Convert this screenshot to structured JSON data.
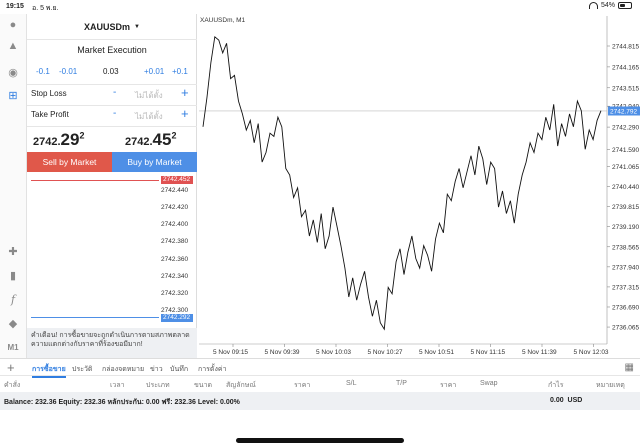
{
  "status": {
    "time": "19:15",
    "date": "อ. 5 พ.ย.",
    "battery": "54%",
    "battery_level": 0.54
  },
  "toolbar": {
    "icons": [
      "person-icon",
      "chat-icon",
      "add-order-icon",
      "crosshair-icon",
      "indicators-icon",
      "function-icon",
      "objects-icon",
      "timeframe-label"
    ],
    "timeframe": "M1"
  },
  "trade": {
    "symbol": "XAUUSDm",
    "execution": "Market Execution",
    "volume_steps": [
      "-0.1",
      "-0.01",
      "+0.01",
      "+0.1"
    ],
    "volume": "0.03",
    "stop_loss_label": "Stop Loss",
    "take_profit_label": "Take Profit",
    "placeholder": "ไม่ได้ตั้ง",
    "minus": "-",
    "plus": "+",
    "sell_price": {
      "small": "2742.",
      "big": "29",
      "sup": "2"
    },
    "buy_price": {
      "small": "2742.",
      "big": "45",
      "sup": "2"
    },
    "sell_label": "Sell by Market",
    "buy_label": "Buy by Market",
    "depth_top_tag": "2742.452",
    "depth_levels": [
      "2742.440",
      "2742.420",
      "2742.400",
      "2742.380",
      "2742.360",
      "2742.340",
      "2742.320",
      "2742.300"
    ],
    "depth_bottom_tag": "2742.292",
    "warning": "คำเตือน! การซื้อขายจะถูกดำเนินการตามสภาพตลาด ความแตกต่างกับราคาที่ร้องขอมีมาก!"
  },
  "chart_data": {
    "type": "line",
    "title": "XAUUSDm, M1",
    "y_ticks": [
      "2744.815",
      "2744.165",
      "2743.515",
      "2742.940",
      "2742.290",
      "2741.590",
      "2741.065",
      "2740.440",
      "2739.815",
      "2739.190",
      "2738.565",
      "2737.940",
      "2737.315",
      "2736.690",
      "2736.065"
    ],
    "current_price": "2742.792",
    "x_ticks": [
      "5 Nov 09:15",
      "5 Nov 09:39",
      "5 Nov 10:03",
      "5 Nov 10:27",
      "5 Nov 10:51",
      "5 Nov 11:15",
      "5 Nov 11:39",
      "5 Nov 12:03"
    ],
    "ylim": [
      2735.6,
      2745.5
    ],
    "series": [
      {
        "values": [
          2742.3,
          2743.2,
          2744.3,
          2745.1,
          2745.0,
          2744.6,
          2744.9,
          2743.8,
          2743.9,
          2743.1,
          2742.7,
          2742.2,
          2742.5,
          2741.8,
          2742.4,
          2741.2,
          2741.5,
          2742.1,
          2742.0,
          2742.6,
          2742.3,
          2741.0,
          2740.8,
          2740.1,
          2740.4,
          2739.5,
          2739.7,
          2738.9,
          2739.4,
          2738.7,
          2739.6,
          2738.5,
          2738.9,
          2739.8,
          2739.2,
          2738.6,
          2737.9,
          2737.0,
          2737.6,
          2736.9,
          2737.4,
          2737.8,
          2737.0,
          2736.4,
          2736.9,
          2736.2,
          2736.0,
          2737.3,
          2737.1,
          2738.1,
          2738.5,
          2737.7,
          2738.4,
          2738.9,
          2738.2,
          2737.9,
          2738.6,
          2738.3,
          2737.8,
          2738.8,
          2739.3,
          2739.0,
          2740.2,
          2740.0,
          2740.6,
          2741.0,
          2740.4,
          2740.9,
          2741.4,
          2740.8,
          2741.7,
          2741.3,
          2740.5,
          2741.2,
          2741.0,
          2739.8,
          2740.3,
          2739.6,
          2740.0,
          2739.3,
          2740.2,
          2740.8,
          2741.2,
          2741.8,
          2741.5,
          2742.1,
          2741.9,
          2742.6,
          2742.2,
          2743.0,
          2741.7,
          2742.4,
          2742.0,
          2742.7,
          2742.3,
          2743.1,
          2742.8,
          2741.6,
          2742.2,
          2741.9,
          2742.5,
          2742.8
        ]
      }
    ]
  },
  "bottom": {
    "tabs": [
      "การซื้อขาย",
      "ประวัติ",
      "กล่องจดหมาย",
      "ข่าว",
      "บันทึก",
      "การตั้งค่า"
    ],
    "columns": [
      "คำสั่ง",
      "เวลา",
      "ประเภท",
      "ขนาด",
      "สัญลักษณ์",
      "ราคา",
      "S/L",
      "T/P",
      "ราคา",
      "Swap",
      "กำไร",
      "หมายเหตุ"
    ],
    "balance_line": "Balance: 232.36 Equity: 232.36 หลักประกัน: 0.00 ฟรี: 232.36 Level: 0.00%",
    "profit": "0.00",
    "currency": "USD"
  }
}
